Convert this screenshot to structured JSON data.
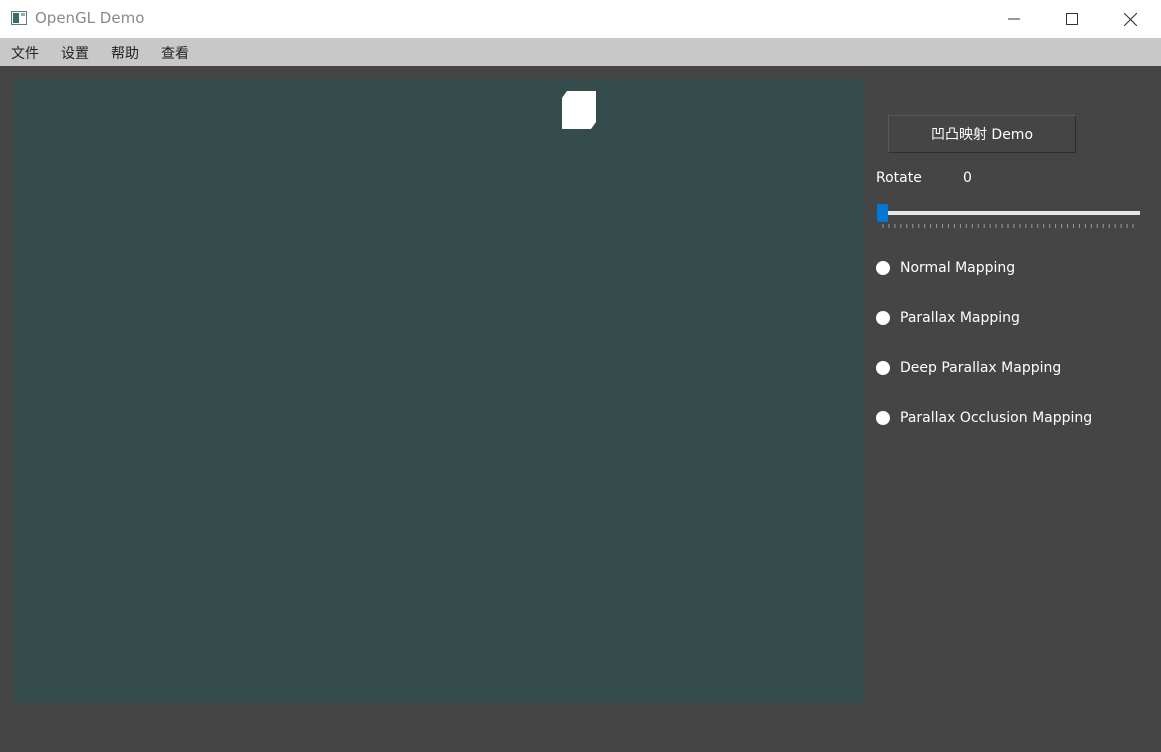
{
  "window": {
    "title": "OpenGL Demo"
  },
  "menubar": {
    "items": [
      "文件",
      "设置",
      "帮助",
      "查看"
    ]
  },
  "panel": {
    "demo_button_label": "凹凸映射 Demo",
    "rotate_label": "Rotate",
    "rotate_value": "0",
    "slider": {
      "value": 0,
      "min": 0,
      "max": 360,
      "accent": "#0078d7"
    },
    "radios": [
      {
        "label": "Normal Mapping",
        "checked": false
      },
      {
        "label": "Parallax Mapping",
        "checked": false
      },
      {
        "label": "Deep Parallax Mapping",
        "checked": false
      },
      {
        "label": "Parallax Occlusion Mapping",
        "checked": false
      }
    ]
  },
  "colors": {
    "viewport_background": "#344c4c",
    "panel_background": "#454545",
    "menubar_background": "#c8c8c8"
  },
  "icons": {
    "app": "app-window-icon",
    "minimize": "minimize-icon",
    "maximize": "maximize-icon",
    "close": "close-icon"
  }
}
